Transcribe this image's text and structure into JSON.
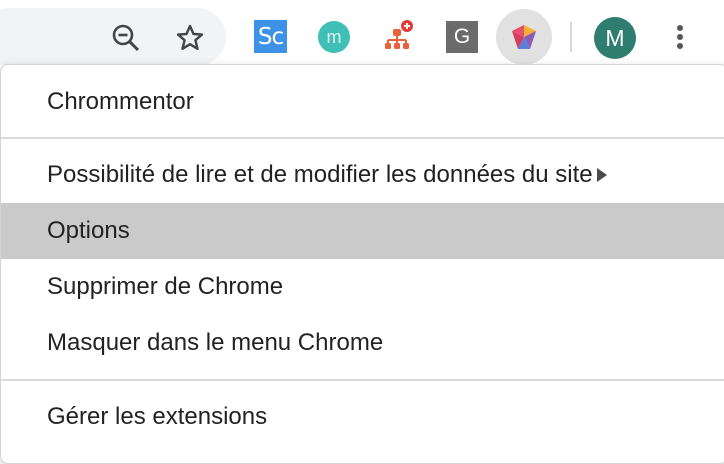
{
  "toolbar": {
    "icons": [
      {
        "name": "zoom-out-icon"
      },
      {
        "name": "bookmark-star-icon"
      },
      {
        "name": "extension-sc-icon",
        "label": "Sc",
        "color": "#3d92e8"
      },
      {
        "name": "extension-m-icon",
        "label": "m",
        "color": "#3fbfb6"
      },
      {
        "name": "extension-sitemap-icon",
        "color": "#e8623a"
      },
      {
        "name": "extension-g-icon",
        "label": "G",
        "color": "#6b6b6b"
      },
      {
        "name": "extension-chrommentor-icon"
      },
      {
        "name": "kebab-menu-icon"
      }
    ],
    "avatar_initial": "M",
    "avatar_color": "#2e7d6f"
  },
  "menu": {
    "extension_name": "Chrommentor",
    "site_access": "Possibilité de lire et de modifier les données du site",
    "options": "Options",
    "remove": "Supprimer de Chrome",
    "hide": "Masquer dans le menu Chrome",
    "manage": "Gérer les extensions",
    "hovered_item": "Options",
    "hover_color": "#cacaca"
  }
}
